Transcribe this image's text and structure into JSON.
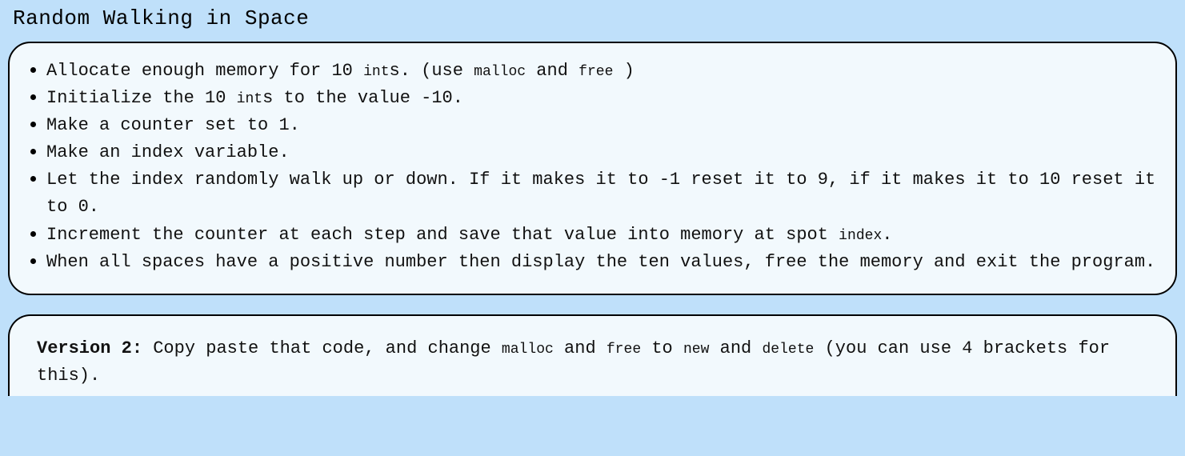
{
  "title": "Random Walking in Space",
  "bullets": [
    {
      "pre": "Allocate enough memory for 10 ",
      "c1": "int",
      "mid1": "s. (use ",
      "c2": "malloc",
      "mid2": " and ",
      "c3": "free",
      "post": " )"
    },
    {
      "pre": "Initialize the 10 ",
      "c1": "int",
      "post": "s to the value -10."
    },
    {
      "text": "Make a counter set to 1."
    },
    {
      "text": "Make an index variable."
    },
    {
      "text": "Let the index randomly walk up or down. If it makes it to -1 reset it to 9, if it makes it to 10 reset it to 0."
    },
    {
      "pre": "Increment the counter at each step and save that value into memory at spot ",
      "c1": "index",
      "post": "."
    },
    {
      "text": "When all spaces have a positive number then display the ten values, free the memory and exit the program."
    }
  ],
  "version2": {
    "label": "Version 2:",
    "pre": " Copy paste that code, and change ",
    "c1": "malloc",
    "mid1": " and ",
    "c2": "free",
    "mid2": " to ",
    "c3": "new",
    "mid3": " and ",
    "c4": "delete",
    "post": " (you can use 4 brackets for this)."
  }
}
